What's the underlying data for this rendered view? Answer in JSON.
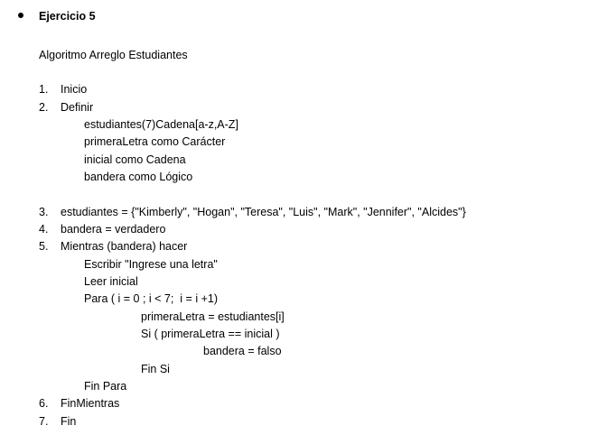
{
  "exercise": {
    "title": "Ejercicio 5",
    "subtitle": "Algoritmo Arreglo Estudiantes"
  },
  "steps": {
    "s1_num": "1.",
    "s1_text": "Inicio",
    "s2_num": "2.",
    "s2_text": "Definir",
    "def1": "estudiantes(7)Cadena[a-z,A-Z]",
    "def2": "primeraLetra como Carácter",
    "def3": "inicial como Cadena",
    "def4": "bandera como Lógico",
    "s3_num": "3.",
    "s3_text": "estudiantes = {\"Kimberly\", \"Hogan\", \"Teresa\", \"Luis\", \"Mark\", \"Jennifer\", \"Alcides\"}",
    "s4_num": "4.",
    "s4_text": "bandera = verdadero",
    "s5_num": "5.",
    "s5_text": "Mientras (bandera) hacer",
    "w1": "Escribir \"Ingrese una letra\"",
    "w2": "Leer inicial",
    "w3": "Para ( i = 0 ; i < 7;  i = i +1)",
    "p1": "primeraLetra = estudiantes[i]",
    "p2": "Si ( primeraLetra == inicial )",
    "p3": "bandera = falso",
    "p4": "Fin Si",
    "w4": "Fin Para",
    "s6_num": "6.",
    "s6_text": "FinMientras",
    "s7_num": "7.",
    "s7_text": "Fin"
  }
}
